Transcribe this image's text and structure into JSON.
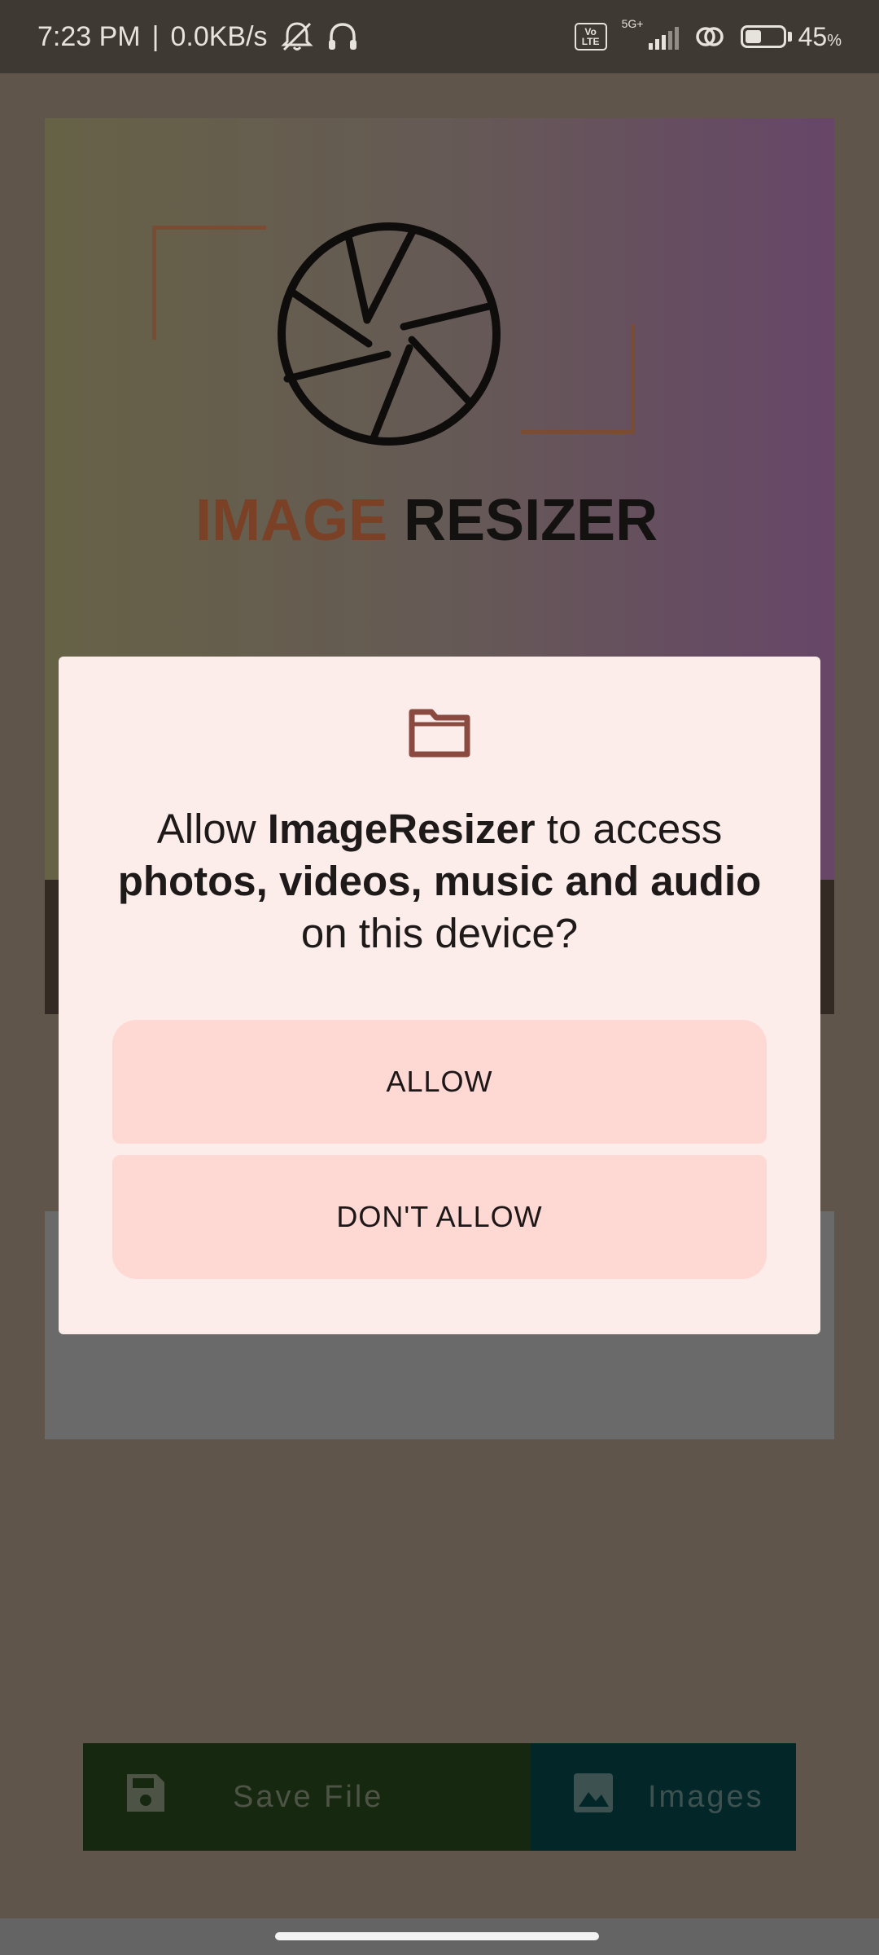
{
  "status_bar": {
    "time": "7:23 PM",
    "separator": "|",
    "speed": "0.0KB/s",
    "volte_top": "Vo",
    "volte_bottom": "LTE",
    "network": "5G+",
    "battery": "45",
    "battery_unit": "%",
    "battery_level": 0.45
  },
  "app": {
    "logo_word1": "IMAGE",
    "logo_word2": "RESIZER",
    "save_button": "Save File",
    "images_button": "Images"
  },
  "dialog": {
    "title_prefix": "Allow ",
    "app_name": "ImageResizer",
    "title_middle": " to access",
    "permission": "photos, videos, music and audio",
    "title_suffix": "on this device?",
    "allow_label": "ALLOW",
    "deny_label": "DON'T ALLOW"
  },
  "colors": {
    "dialog_bg": "#fcecea",
    "button_bg": "#fed8d3",
    "folder_icon": "#8b4a40"
  }
}
